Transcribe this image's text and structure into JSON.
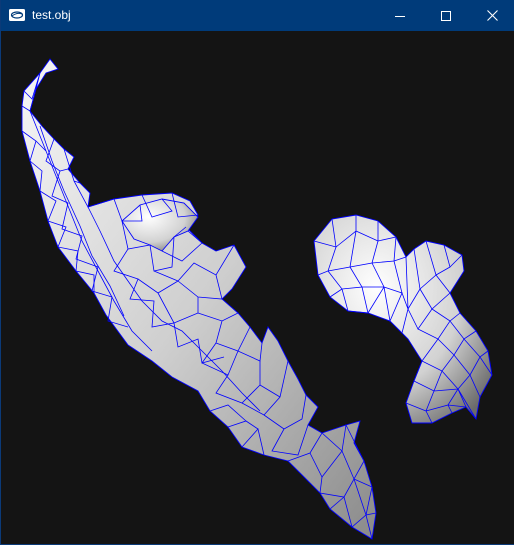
{
  "window": {
    "title": "test.obj",
    "app_icon": "obj-viewer-icon",
    "controls": {
      "minimize_icon": "minimize-icon",
      "maximize_icon": "maximize-icon",
      "close_icon": "close-icon"
    }
  },
  "viewport": {
    "background_color": "#141414",
    "wireframe_color": "#0000ff",
    "shading": "gray-gradient",
    "model": "3d-mesh"
  },
  "colors": {
    "titlebar": "#003b7a",
    "title_text": "#ffffff"
  }
}
